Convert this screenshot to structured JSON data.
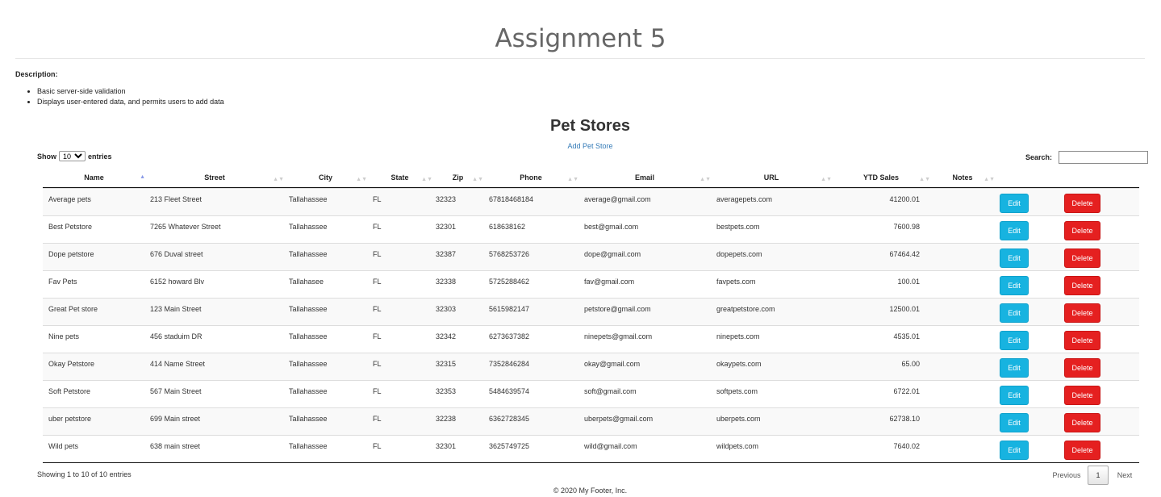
{
  "page": {
    "title": "Assignment 5",
    "description_label": "Description:",
    "description_items": [
      "Basic server-side validation",
      "Displays user-entered data, and permits users to add data"
    ]
  },
  "section": {
    "title": "Pet Stores",
    "add_link": "Add Pet Store"
  },
  "controls": {
    "show_label": "Show",
    "entries_label": "entries",
    "page_length": "10",
    "search_label": "Search:",
    "search_value": ""
  },
  "table": {
    "columns": [
      "Name",
      "Street",
      "City",
      "State",
      "Zip",
      "Phone",
      "Email",
      "URL",
      "YTD Sales",
      "Notes"
    ],
    "sorted_column": "Name",
    "edit_label": "Edit",
    "delete_label": "Delete",
    "rows": [
      {
        "name": "Average pets",
        "street": "213 Fleet Street",
        "city": "Tallahassee",
        "state": "FL",
        "zip": "32323",
        "phone": "67818468184",
        "email": "average@gmail.com",
        "url": "averagepets.com",
        "ytd": "41200.01",
        "notes": ""
      },
      {
        "name": "Best Petstore",
        "street": "7265 Whatever Street",
        "city": "Tallahassee",
        "state": "FL",
        "zip": "32301",
        "phone": "618638162",
        "email": "best@gmail.com",
        "url": "bestpets.com",
        "ytd": "7600.98",
        "notes": ""
      },
      {
        "name": "Dope petstore",
        "street": "676 Duval street",
        "city": "Tallahassee",
        "state": "FL",
        "zip": "32387",
        "phone": "5768253726",
        "email": "dope@gmail.com",
        "url": "dopepets.com",
        "ytd": "67464.42",
        "notes": ""
      },
      {
        "name": "Fav Pets",
        "street": "6152 howard Blv",
        "city": "Tallahasee",
        "state": "FL",
        "zip": "32338",
        "phone": "5725288462",
        "email": "fav@gmail.com",
        "url": "favpets.com",
        "ytd": "100.01",
        "notes": ""
      },
      {
        "name": "Great Pet store",
        "street": "123 Main Street",
        "city": "Tallahassee",
        "state": "FL",
        "zip": "32303",
        "phone": "5615982147",
        "email": "petstore@gmail.com",
        "url": "greatpetstore.com",
        "ytd": "12500.01",
        "notes": ""
      },
      {
        "name": "Nine pets",
        "street": "456 staduim DR",
        "city": "Tallahassee",
        "state": "FL",
        "zip": "32342",
        "phone": "6273637382",
        "email": "ninepets@gmail.com",
        "url": "ninepets.com",
        "ytd": "4535.01",
        "notes": ""
      },
      {
        "name": "Okay Petstore",
        "street": "414 Name Street",
        "city": "Tallahassee",
        "state": "FL",
        "zip": "32315",
        "phone": "7352846284",
        "email": "okay@gmail.com",
        "url": "okaypets.com",
        "ytd": "65.00",
        "notes": ""
      },
      {
        "name": "Soft Petstore",
        "street": "567 Main Street",
        "city": "Tallahassee",
        "state": "FL",
        "zip": "32353",
        "phone": "5484639574",
        "email": "soft@gmail.com",
        "url": "softpets.com",
        "ytd": "6722.01",
        "notes": ""
      },
      {
        "name": "uber petstore",
        "street": "699 Main street",
        "city": "Tallahassee",
        "state": "FL",
        "zip": "32238",
        "phone": "6362728345",
        "email": "uberpets@gmail.com",
        "url": "uberpets.com",
        "ytd": "62738.10",
        "notes": ""
      },
      {
        "name": "Wild pets",
        "street": "638 main street",
        "city": "Tallahassee",
        "state": "FL",
        "zip": "32301",
        "phone": "3625749725",
        "email": "wild@gmail.com",
        "url": "wildpets.com",
        "ytd": "7640.02",
        "notes": ""
      }
    ]
  },
  "pagination": {
    "info": "Showing 1 to 10 of 10 entries",
    "previous": "Previous",
    "current_page": "1",
    "next": "Next"
  },
  "footer": {
    "text": "© 2020 My Footer, Inc."
  }
}
